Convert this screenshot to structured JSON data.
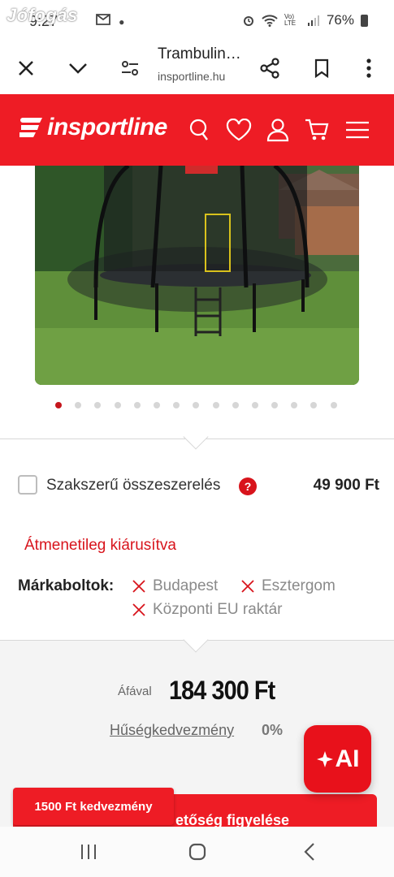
{
  "status_bar": {
    "time": "9:27",
    "watermark": "Jófogás",
    "battery": "76%",
    "network": "Vo) LTE"
  },
  "browser": {
    "page_title": "Trambulin…",
    "url": "insportline.hu",
    "icons": [
      "close-icon",
      "chevron-down-icon",
      "site-settings-icon",
      "share-icon",
      "bookmark-icon",
      "more-icon"
    ]
  },
  "site": {
    "logo_text": "insportline",
    "header_icons": [
      "search-icon",
      "heart-icon",
      "user-icon",
      "cart-icon",
      "menu-icon"
    ],
    "brand_color": "#ee1c25"
  },
  "gallery": {
    "total_images": 15,
    "active_index": 0
  },
  "assembly": {
    "label": "Szakszerű összeszerelés",
    "help": "?",
    "price": "49 900 Ft",
    "checked": false
  },
  "availability": {
    "status": "Átmenetileg kiárusítva",
    "stores_label": "Márkaboltok:",
    "stores": [
      "Budapest",
      "Esztergom",
      "Központi EU raktár"
    ]
  },
  "pricing": {
    "vat_label": "Áfával",
    "price": "184 300 Ft",
    "loyalty_label": "Hűségkedvezmény",
    "loyalty_value": "0%"
  },
  "ai_button": {
    "label": "AI"
  },
  "watch_button": {
    "label": "etőség figyelése"
  },
  "discount_badge": {
    "label": "1500 Ft kedvezmény"
  },
  "nav_bar": {
    "icons": [
      "recent-apps-icon",
      "home-icon",
      "back-icon"
    ]
  }
}
